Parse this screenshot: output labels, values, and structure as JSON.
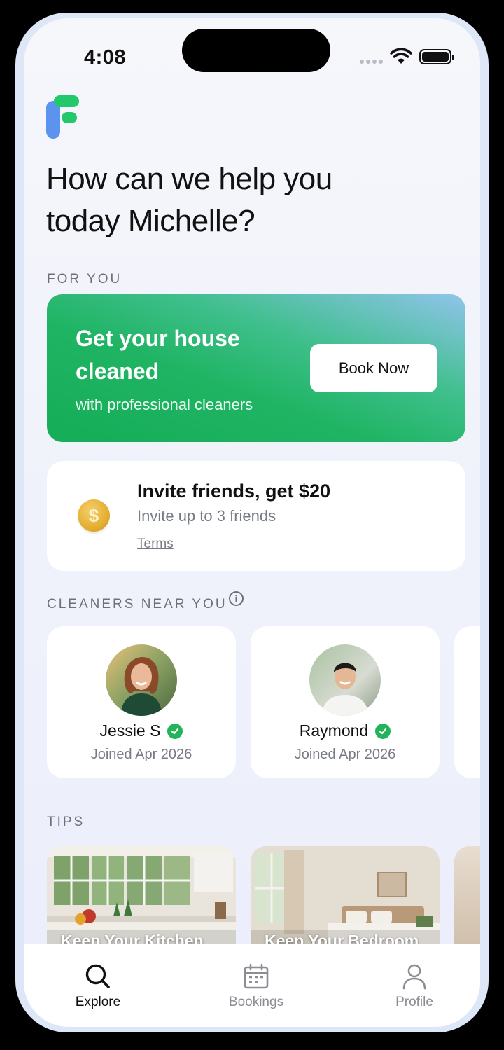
{
  "status_bar": {
    "time": "4:08"
  },
  "headline": "How can we help you today Michelle?",
  "sections": {
    "for_you": "FOR YOU",
    "cleaners_near_you": "CLEANERS NEAR YOU",
    "tips": "TIPS"
  },
  "promo": {
    "title": "Get your house cleaned",
    "subtitle": "with professional cleaners",
    "button_label": "Book Now"
  },
  "invite": {
    "title": "Invite friends, get $20",
    "subtitle": "Invite up to 3 friends",
    "terms_label": "Terms",
    "coin_symbol": "$"
  },
  "cleaners": [
    {
      "name": "Jessie S",
      "joined": "Joined Apr 2026",
      "verified": true
    },
    {
      "name": "Raymond",
      "joined": "Joined Apr 2026",
      "verified": true
    }
  ],
  "tips": [
    {
      "label": "Keep Your Kitchen"
    },
    {
      "label": "Keep Your Bedroom"
    }
  ],
  "tabbar": {
    "explore": "Explore",
    "bookings": "Bookings",
    "profile": "Profile",
    "active": "explore"
  },
  "colors": {
    "brand_green": "#22c86a",
    "brand_blue": "#5b93ee",
    "verified_green": "#22b35b"
  }
}
